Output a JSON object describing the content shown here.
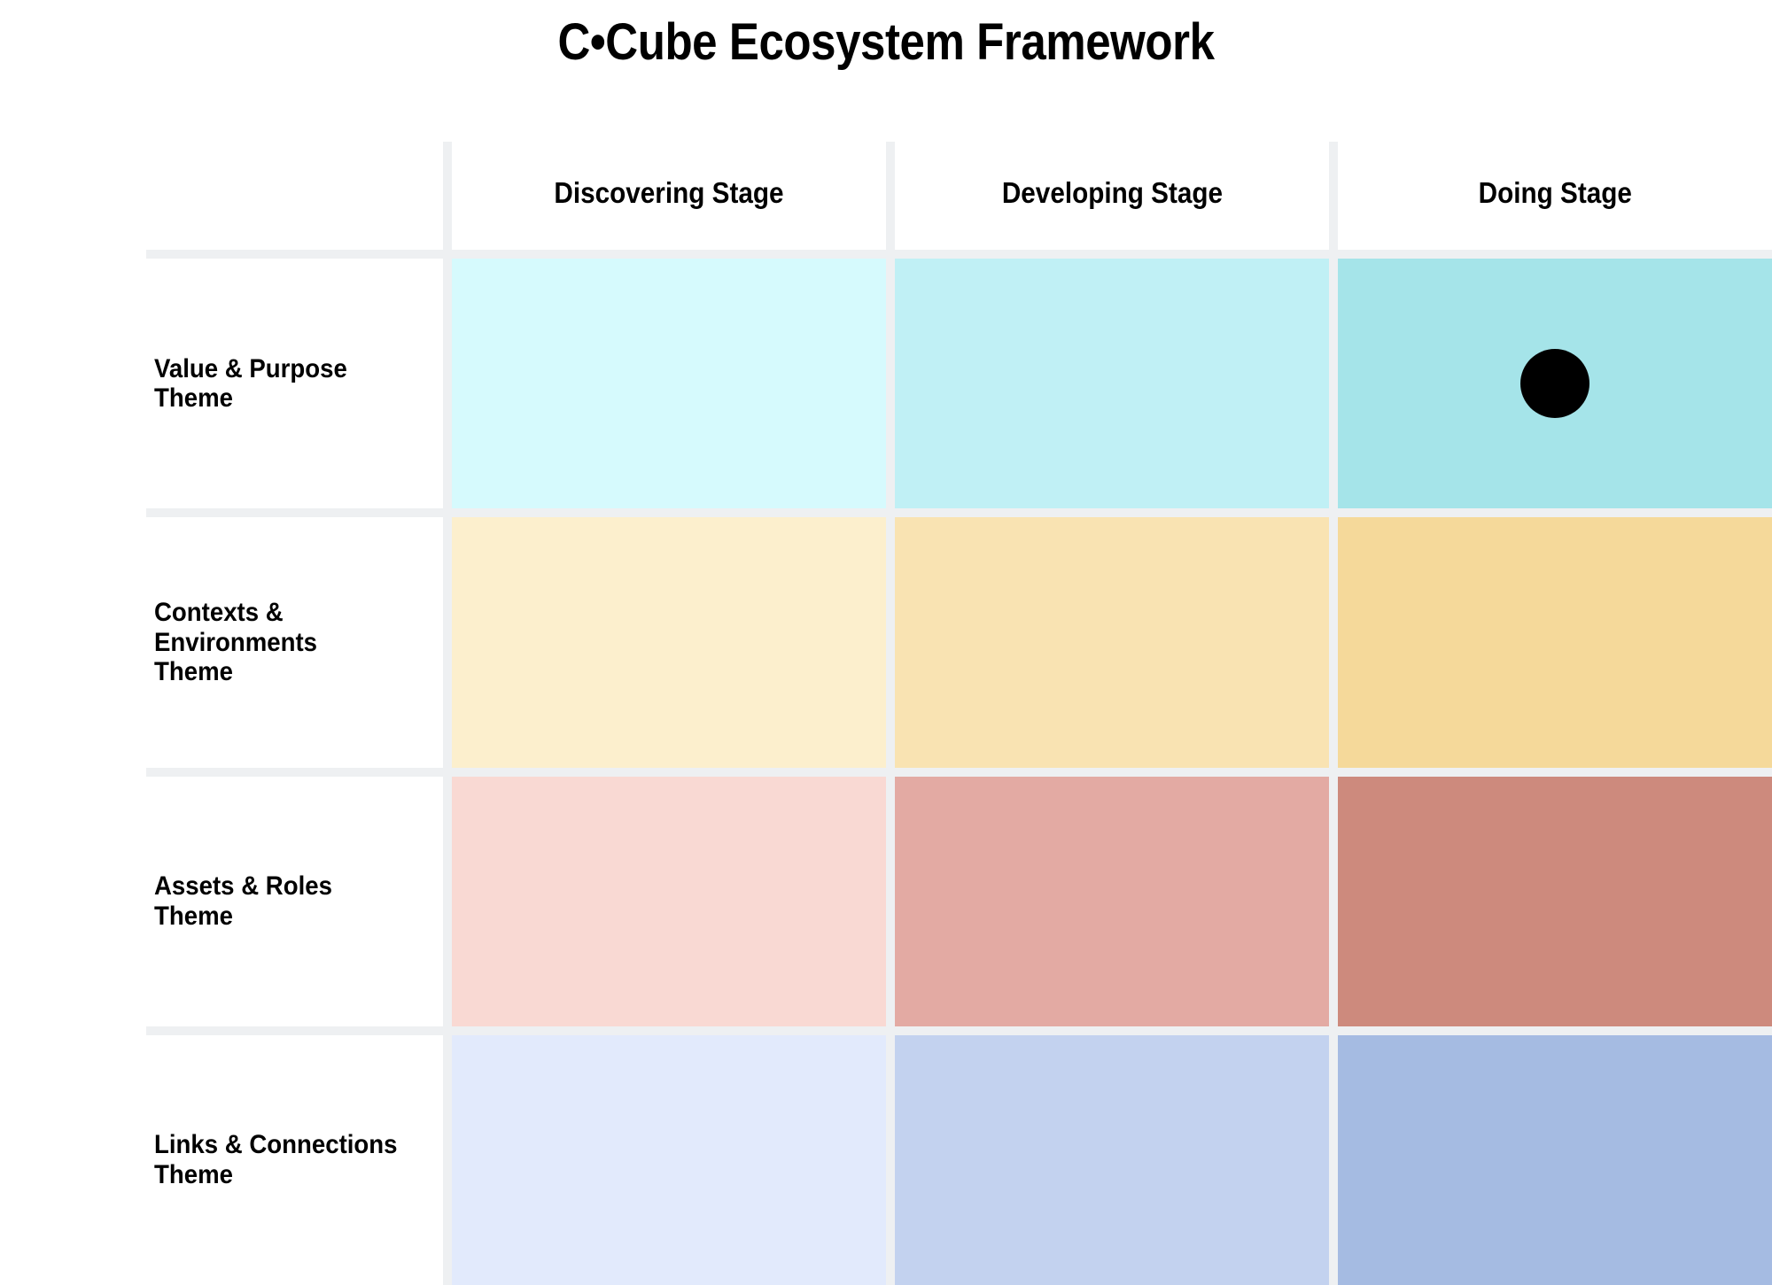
{
  "title": "C•Cube Ecosystem Framework",
  "matrix": {
    "column_headers": [
      {
        "label": "Discovering Stage"
      },
      {
        "label": "Developing Stage"
      },
      {
        "label": "Doing Stage"
      }
    ],
    "row_headers": [
      {
        "label": "Value & Purpose Theme"
      },
      {
        "label": "Contexts & Environments Theme"
      },
      {
        "label": "Assets & Roles Theme"
      },
      {
        "label": "Links & Connections Theme"
      }
    ],
    "grid_gap_color": "#eef0f2",
    "background_color": "#ffffff",
    "marker_color": "#000000",
    "rows": [
      {
        "theme": "Value & Purpose Theme",
        "cells": [
          {
            "stage": "Discovering Stage",
            "color": "#d6fafd",
            "marker": false
          },
          {
            "stage": "Developing Stage",
            "color": "#c0f0f5",
            "marker": false
          },
          {
            "stage": "Doing Stage",
            "color": "#a5e4e9",
            "marker": true
          }
        ]
      },
      {
        "theme": "Contexts & Environments Theme",
        "cells": [
          {
            "stage": "Discovering Stage",
            "color": "#fcefcd",
            "marker": false
          },
          {
            "stage": "Developing Stage",
            "color": "#f9e3b2",
            "marker": false
          },
          {
            "stage": "Doing Stage",
            "color": "#f5d99a",
            "marker": false
          }
        ]
      },
      {
        "theme": "Assets & Roles Theme",
        "cells": [
          {
            "stage": "Discovering Stage",
            "color": "#f9d9d3",
            "marker": false
          },
          {
            "stage": "Developing Stage",
            "color": "#e3aaa3",
            "marker": false
          },
          {
            "stage": "Doing Stage",
            "color": "#cd8a7d",
            "marker": false
          }
        ]
      },
      {
        "theme": "Links & Connections Theme",
        "cells": [
          {
            "stage": "Discovering Stage",
            "color": "#e2eafc",
            "marker": false
          },
          {
            "stage": "Developing Stage",
            "color": "#c3d2ef",
            "marker": false
          },
          {
            "stage": "Doing Stage",
            "color": "#a5bbe2",
            "marker": false
          }
        ]
      }
    ]
  },
  "chart_data": {
    "type": "heatmap",
    "title": "C•Cube Ecosystem Framework",
    "xlabel": "",
    "ylabel": "",
    "categories": [
      "Discovering Stage",
      "Developing Stage",
      "Doing Stage"
    ],
    "rows": [
      "Value & Purpose Theme",
      "Contexts & Environments Theme",
      "Assets & Roles Theme",
      "Links & Connections Theme"
    ],
    "series": [
      {
        "name": "Value & Purpose Theme",
        "values": [
          1,
          2,
          3
        ]
      },
      {
        "name": "Contexts & Environments Theme",
        "values": [
          1,
          2,
          3
        ]
      },
      {
        "name": "Assets & Roles Theme",
        "values": [
          1,
          2,
          3
        ]
      },
      {
        "name": "Links & Connections Theme",
        "values": [
          1,
          2,
          3
        ]
      }
    ],
    "annotations": [
      {
        "label": "current-position-marker",
        "row": "Value & Purpose Theme",
        "column": "Doing Stage",
        "shape": "filled-circle",
        "color": "#000000"
      }
    ],
    "grid": true,
    "legend": "none"
  }
}
